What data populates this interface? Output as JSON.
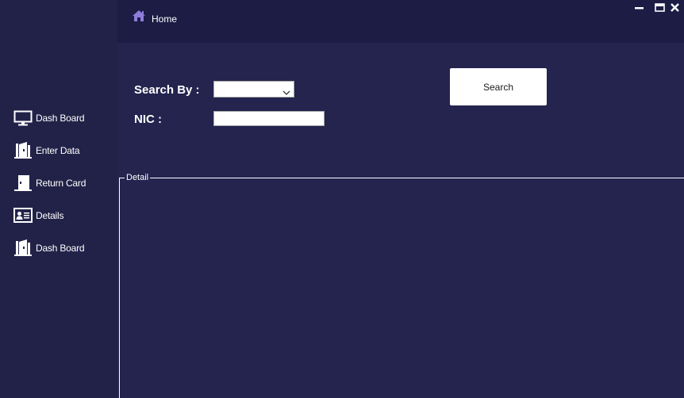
{
  "header": {
    "home_label": "Home",
    "home_icon": "home-icon",
    "accent_color": "#8e7cd9"
  },
  "window_controls": {
    "minimize_icon": "minimize-icon",
    "maximize_icon": "maximize-icon",
    "close_icon": "close-icon"
  },
  "sidebar": {
    "items": [
      {
        "label": "Dash Board",
        "icon": "monitor-icon"
      },
      {
        "label": "Enter Data",
        "icon": "door-enter-icon"
      },
      {
        "label": "Return Card",
        "icon": "door-exit-icon"
      },
      {
        "label": "Details",
        "icon": "id-card-icon"
      },
      {
        "label": "Dash Board",
        "icon": "door-open-icon"
      }
    ]
  },
  "search_form": {
    "search_by_label": "Search By :",
    "search_by_value": "",
    "nic_label": "NIC :",
    "nic_value": "",
    "search_button_label": "Search"
  },
  "detail_group": {
    "label": "Detail"
  }
}
